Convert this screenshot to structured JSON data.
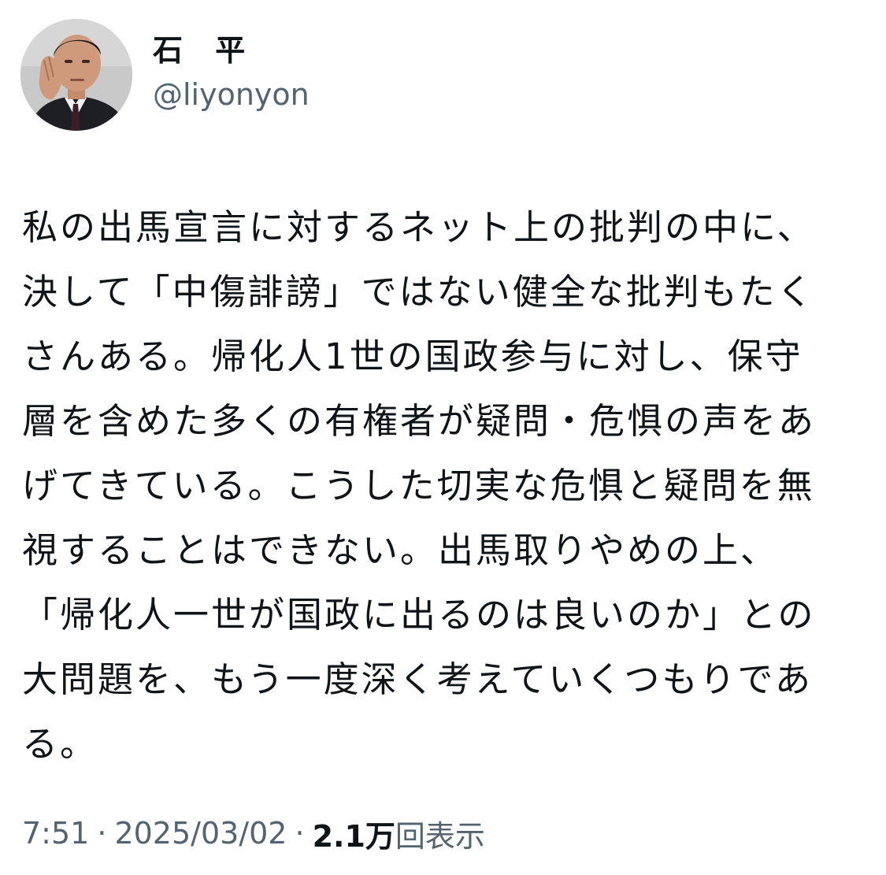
{
  "author": {
    "display_name": "石 平",
    "handle": "@liyonyon"
  },
  "tweet": {
    "lines": [
      "私の出馬宣言に対するネット上の批判の中に、",
      "決して「中傷誹謗」ではない健全な批判もたく",
      "さんある。帰化人1世の国政参与に対し、保守",
      "層を含めた多くの有権者が疑問・危惧の声をあ",
      "げてきている。こうした切実な危惧と疑問を無",
      "視することはできない。出馬取りやめの上、",
      "「帰化人一世が国政に出るのは良いのか」との",
      "大問題を、もう一度深く考えていくつもりであ",
      "る。"
    ]
  },
  "meta": {
    "time": "7:51",
    "separator": "·",
    "date": "2025/03/02",
    "views_count": "2.1万",
    "views_label": "回表示"
  },
  "colors": {
    "text_primary": "#0f1419",
    "text_secondary": "#536471",
    "background": "#ffffff"
  }
}
